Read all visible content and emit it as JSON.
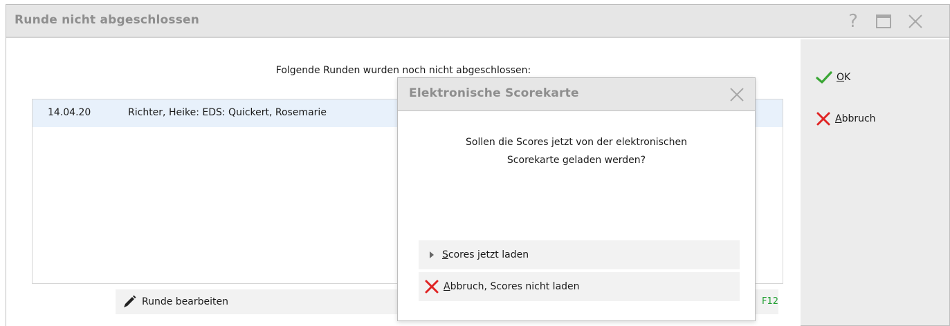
{
  "window": {
    "title": "Runde nicht abgeschlossen",
    "help_glyph": "?"
  },
  "main": {
    "heading": "Folgende Runden wurden noch nicht abgeschlossen:",
    "rows": [
      {
        "date": "14.04.20",
        "name": "Richter, Heike: EDS: Quickert, Rosemarie"
      }
    ],
    "edit_button": {
      "label": "Runde bearbeiten",
      "shortcut": "F12"
    }
  },
  "side": {
    "ok": {
      "mnemonic": "O",
      "rest": "K"
    },
    "cancel": {
      "mnemonic": "A",
      "rest": "bbruch"
    }
  },
  "modal": {
    "title": "Elektronische Scorekarte",
    "message_line1": "Sollen die Scores jetzt von der elektronischen",
    "message_line2": "Scorekarte geladen werden?",
    "load": {
      "mnemonic": "S",
      "rest": "cores jetzt laden"
    },
    "cancel": {
      "mnemonic": "A",
      "rest": "bbruch, Scores nicht laden"
    }
  },
  "colors": {
    "ok_check": "#3aa635",
    "cancel_x": "#e02424",
    "shortcut_green": "#22a033",
    "titlebar": "#e6e6e6",
    "side_panel": "#ececec",
    "row_selected": "#e8f1fb"
  },
  "icons": [
    "help-icon",
    "maximize-icon",
    "close-icon",
    "pencil-icon",
    "checkmark-icon",
    "x-icon",
    "triangle-right-icon"
  ]
}
